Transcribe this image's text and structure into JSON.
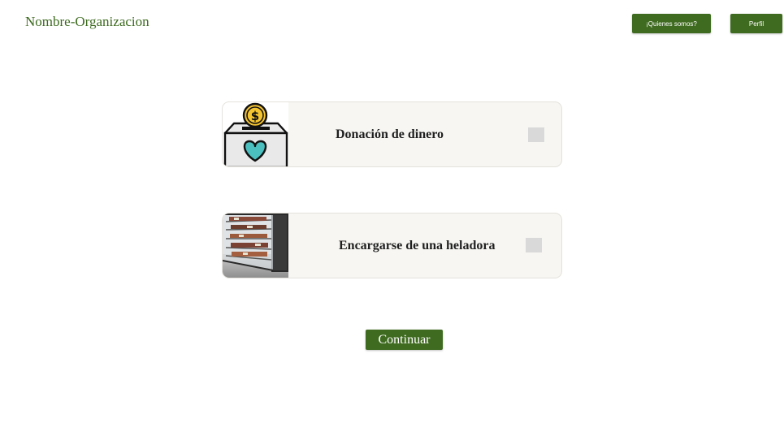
{
  "header": {
    "org_name": "Nombre-Organizacion",
    "about_label": "¡Quienes somos?",
    "profile_label": "Perfil"
  },
  "options": [
    {
      "label": "Donación de dinero",
      "icon": "donation-box-icon",
      "checked": false
    },
    {
      "label": "Encargarse de una heladora",
      "icon": "fridge-display-image",
      "checked": false
    }
  ],
  "actions": {
    "continue_label": "Continuar"
  },
  "colors": {
    "brand_green": "#3f6b20",
    "card_bg": "#f7f6f2",
    "checkbox_gray": "#d9d9d9",
    "heart": "#4bbfbf",
    "coin": "#f5c431"
  }
}
